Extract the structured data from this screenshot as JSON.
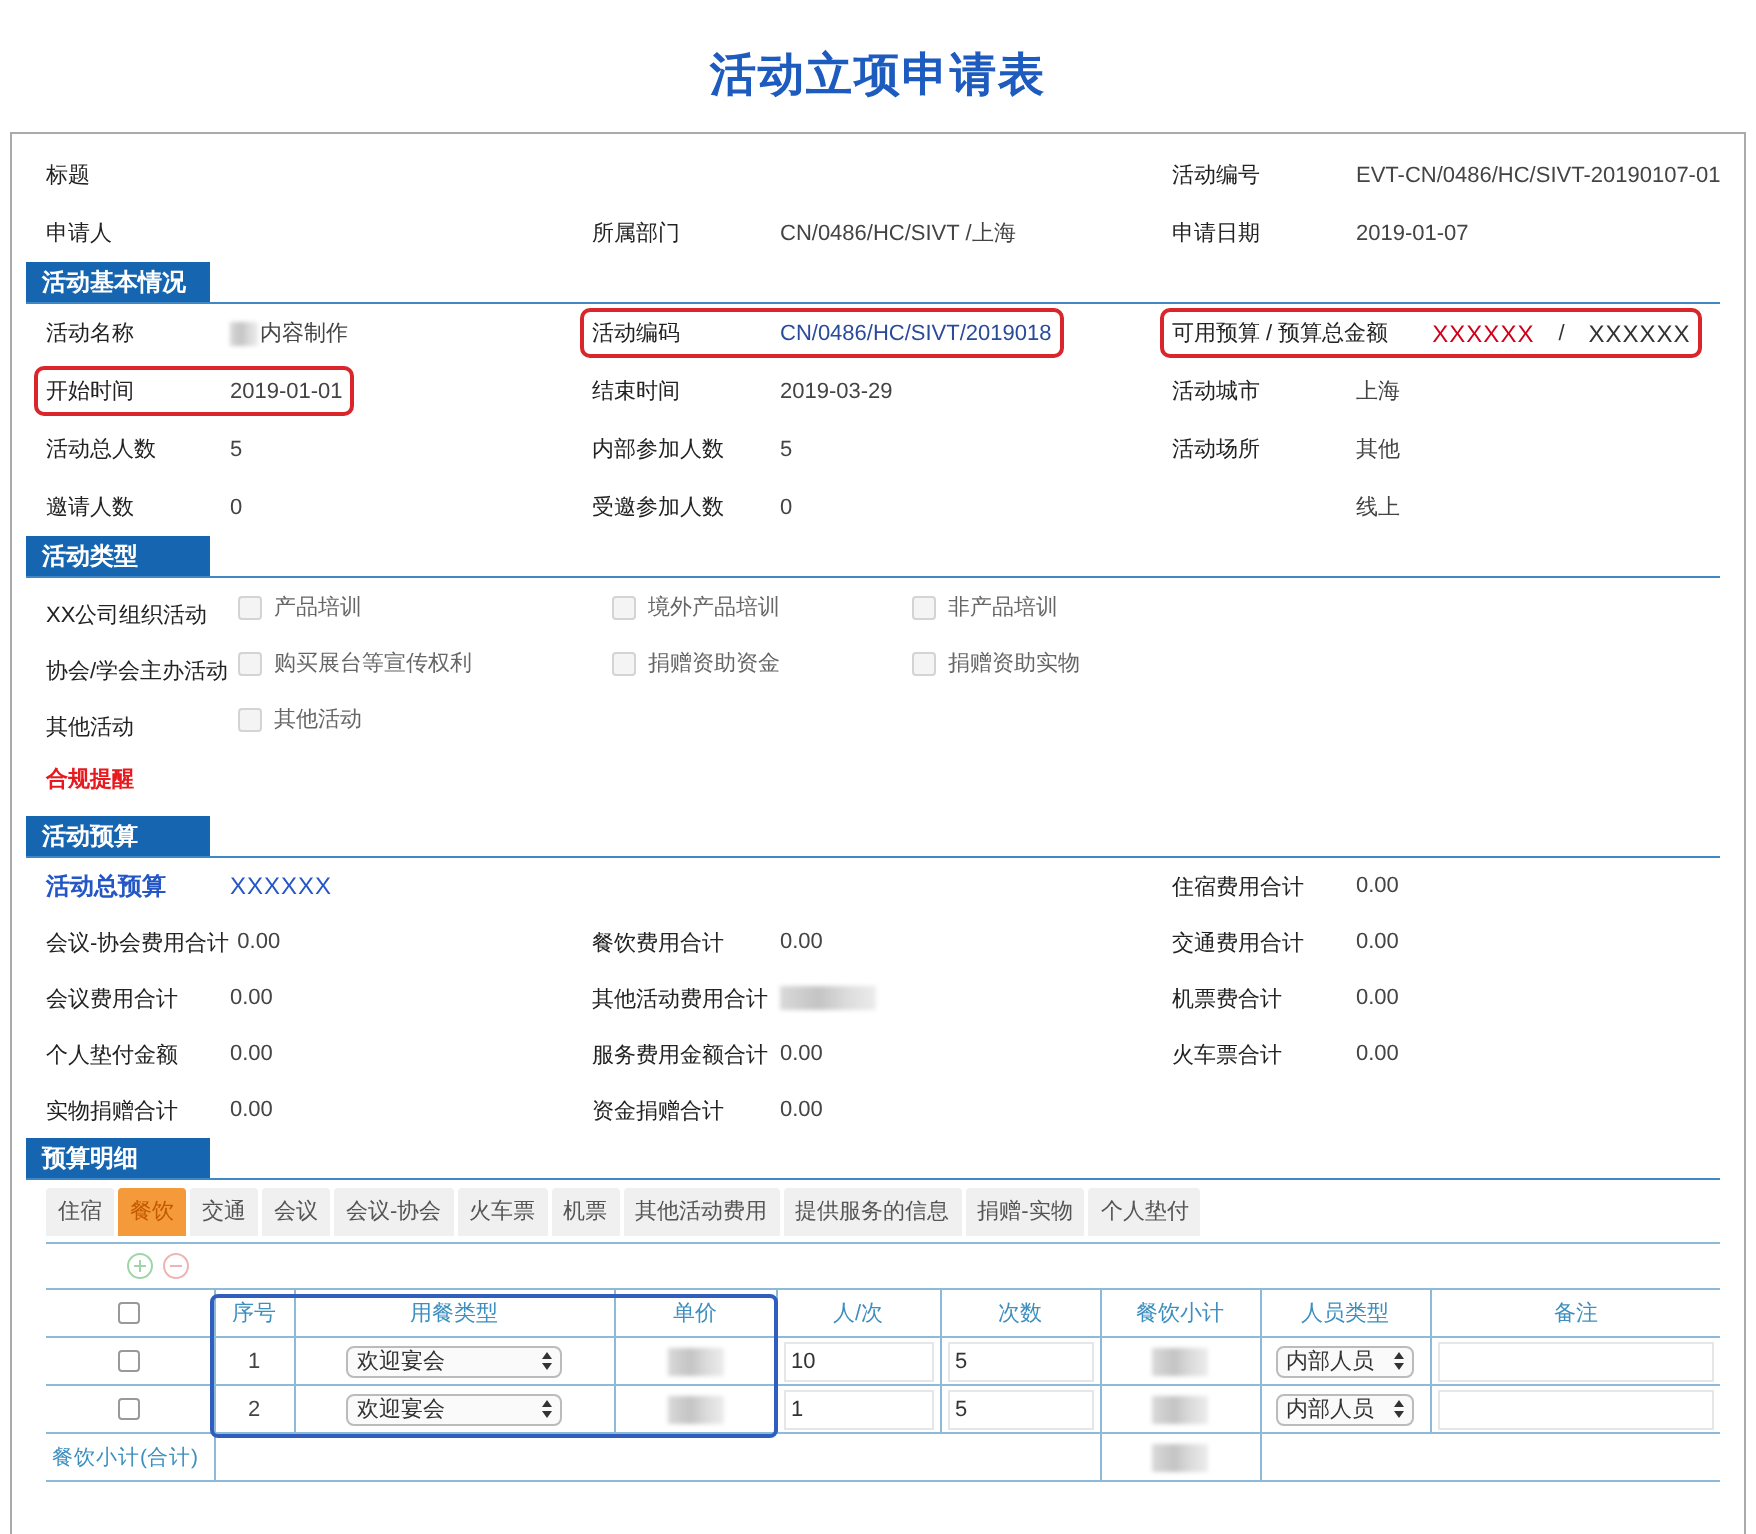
{
  "title": "活动立项申请表",
  "sections": [
    {
      "kind": "fields",
      "rows": [
        [
          {
            "label": "标题"
          },
          null,
          {
            "label": "活动编号",
            "value": "EVT-CN/0486/HC/SIVT-20190107-01",
            "kind": "text"
          }
        ],
        [
          {
            "label": "申请人"
          },
          {
            "label": "所属部门",
            "value": "CN/0486/HC/SIVT  /上海",
            "kind": "text"
          },
          {
            "label": "申请日期",
            "value": "2019-01-07",
            "kind": "text"
          }
        ]
      ]
    },
    {
      "kind": "fields",
      "title": "活动基本情况",
      "rows": [
        [
          {
            "label": "活动名称",
            "value": "内容制作",
            "kind": "redacted-prefix",
            "highlighted": false
          },
          {
            "label": "活动编码",
            "value": "CN/0486/HC/SIVT/2019018",
            "kind": "link",
            "highlighted": true
          },
          {
            "label": "可用预算 / 预算总金额",
            "kind": "budget",
            "available": "XXXXXX",
            "separator": "/",
            "total": "XXXXXX",
            "highlighted": true
          }
        ],
        [
          {
            "label": "开始时间",
            "value": "2019-01-01",
            "kind": "text",
            "highlighted": true
          },
          {
            "label": "结束时间",
            "value": "2019-03-29",
            "kind": "text",
            "highlighted": false
          },
          {
            "label": "活动城市",
            "value": "上海",
            "kind": "text",
            "highlighted": false
          }
        ],
        [
          {
            "label": "活动总人数",
            "value": "5",
            "kind": "text",
            "highlighted": false
          },
          {
            "label": "内部参加人数",
            "value": "5",
            "kind": "text",
            "highlighted": false
          },
          {
            "label": "活动场所",
            "value": "其他",
            "kind": "text",
            "highlighted": false
          }
        ],
        [
          {
            "label": "邀请人数",
            "value": "0",
            "kind": "text",
            "highlighted": false
          },
          {
            "label": "受邀参加人数",
            "value": "0",
            "kind": "text",
            "highlighted": false
          },
          {
            "value": "线上",
            "kind": "text",
            "highlighted": false
          }
        ]
      ]
    },
    {
      "kind": "types",
      "title": "活动类型",
      "rows": [
        {
          "label": "XX公司组织活动",
          "options": [
            {
              "label": "产品培训",
              "checked": false
            },
            {
              "label": "境外产品培训",
              "checked": false
            },
            {
              "label": "非产品培训",
              "checked": false
            }
          ]
        },
        {
          "label": "协会/学会主办活动",
          "options": [
            {
              "label": "购买展台等宣传权利",
              "checked": false
            },
            {
              "label": "捐赠资助资金",
              "checked": false
            },
            {
              "label": "捐赠资助实物",
              "checked": false
            }
          ]
        },
        {
          "label": "其他活动",
          "options": [
            {
              "label": "其他活动",
              "checked": false
            }
          ]
        }
      ],
      "alert": "合规提醒"
    },
    {
      "kind": "fields",
      "title": "活动预算",
      "rows": [
        [
          {
            "label": "活动总预算",
            "value": "XXXXXX",
            "kind": "total"
          },
          null,
          {
            "label": "住宿费用合计",
            "value": "0.00",
            "kind": "text"
          }
        ],
        [
          {
            "label": "会议-协会费用合计",
            "value": "0.00",
            "kind": "text"
          },
          {
            "label": "餐饮费用合计",
            "value": "0.00",
            "kind": "text"
          },
          {
            "label": "交通费用合计",
            "value": "0.00",
            "kind": "text"
          }
        ],
        [
          {
            "label": "会议费用合计",
            "value": "0.00",
            "kind": "text"
          },
          {
            "label": "其他活动费用合计",
            "kind": "redacted"
          },
          {
            "label": "机票费合计",
            "value": "0.00",
            "kind": "text"
          }
        ],
        [
          {
            "label": "个人垫付金额",
            "value": "0.00",
            "kind": "text"
          },
          {
            "label": "服务费用金额合计",
            "value": "0.00",
            "kind": "text"
          },
          {
            "label": "火车票合计",
            "value": "0.00",
            "kind": "text"
          }
        ],
        [
          {
            "label": "实物捐赠合计",
            "value": "0.00",
            "kind": "text"
          },
          {
            "label": "资金捐赠合计",
            "value": "0.00",
            "kind": "text"
          },
          null
        ]
      ]
    },
    {
      "kind": "detail",
      "title": "预算明细",
      "tabs": [
        {
          "label": "住宿",
          "selected": false
        },
        {
          "label": "餐饮",
          "selected": true
        },
        {
          "label": "交通",
          "selected": false
        },
        {
          "label": "会议",
          "selected": false
        },
        {
          "label": "会议-协会",
          "selected": false
        },
        {
          "label": "火车票",
          "selected": false
        },
        {
          "label": "机票",
          "selected": false
        },
        {
          "label": "其他活动费用",
          "selected": false
        },
        {
          "label": "提供服务的信息",
          "selected": false
        },
        {
          "label": "捐赠-实物",
          "selected": false
        },
        {
          "label": "个人垫付",
          "selected": false
        }
      ],
      "select_all": {
        "checked": false
      },
      "columns": [
        {
          "label": "序号",
          "highlighted": true
        },
        {
          "label": "用餐类型",
          "highlighted": true
        },
        {
          "label": "单价",
          "highlighted": true
        },
        {
          "label": "人/次",
          "highlighted": false
        },
        {
          "label": "次数",
          "highlighted": false
        },
        {
          "label": "餐饮小计",
          "highlighted": false
        },
        {
          "label": "人员类型",
          "highlighted": false
        },
        {
          "label": "备注",
          "highlighted": false
        }
      ],
      "rows": [
        {
          "checked": false,
          "cells": [
            {
              "kind": "text",
              "value": "1"
            },
            {
              "kind": "select",
              "value": "欢迎宴会"
            },
            {
              "kind": "redacted"
            },
            {
              "kind": "input",
              "value": "10"
            },
            {
              "kind": "input",
              "value": "5"
            },
            {
              "kind": "redacted"
            },
            {
              "kind": "select",
              "value": "内部人员"
            },
            {
              "kind": "input"
            }
          ]
        },
        {
          "checked": false,
          "cells": [
            {
              "kind": "text",
              "value": "2"
            },
            {
              "kind": "select",
              "value": "欢迎宴会"
            },
            {
              "kind": "redacted"
            },
            {
              "kind": "input",
              "value": "1"
            },
            {
              "kind": "input",
              "value": "5"
            },
            {
              "kind": "redacted"
            },
            {
              "kind": "select",
              "value": "内部人员"
            },
            {
              "kind": "input"
            }
          ]
        }
      ],
      "subtotal": {
        "label": "餐饮小计(合计)",
        "redacted": true
      }
    }
  ]
}
